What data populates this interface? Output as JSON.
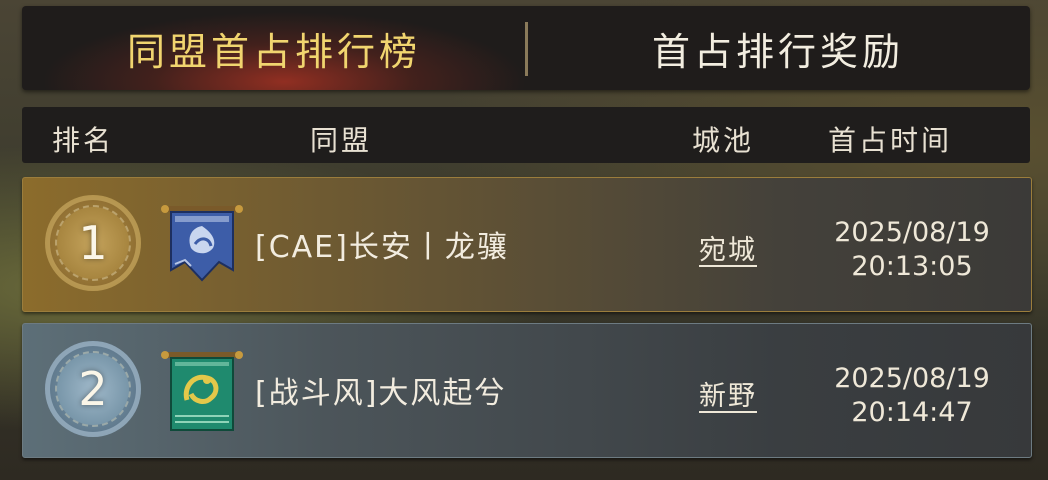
{
  "tabs": {
    "active_label": "同盟首占排行榜",
    "inactive_label": "首占排行奖励"
  },
  "header": {
    "rank": "排名",
    "alliance": "同盟",
    "city": "城池",
    "first_time": "首占时间"
  },
  "rows": [
    {
      "rank": "1",
      "alliance": "[CAE]长安丨龙骧",
      "city": "宛城",
      "date": "2025/08/19",
      "time": "20:13:05",
      "banner_icon": "blue-phoenix-banner-icon",
      "banner_color": "#3d5da8",
      "medal_color": "#b0904a"
    },
    {
      "rank": "2",
      "alliance": "[战斗风]大风起兮",
      "city": "新野",
      "date": "2025/08/19",
      "time": "20:14:47",
      "banner_icon": "green-dragon-banner-icon",
      "banner_color": "#1f8a6e",
      "medal_color": "#86a3b6"
    }
  ],
  "colors": {
    "active_tab_text": "#f1d56f",
    "panel_bg": "#1f1c1b",
    "gold_row": "#8c6c2c",
    "silver_row": "#5d6f78"
  }
}
